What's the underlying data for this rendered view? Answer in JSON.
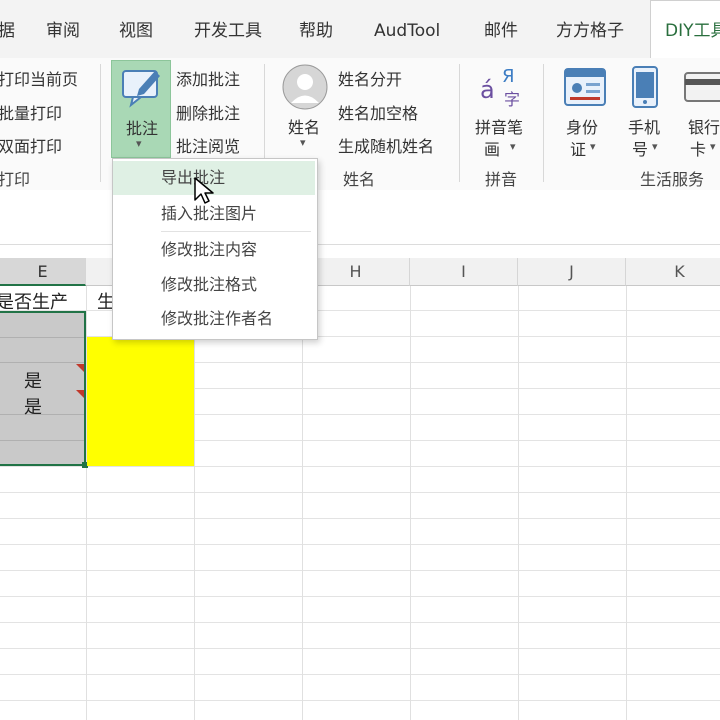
{
  "tabs": [
    "据",
    "审阅",
    "视图",
    "开发工具",
    "帮助",
    "AudTool",
    "邮件",
    "方方格子",
    "DIY工具"
  ],
  "ribbon": {
    "print": {
      "items": [
        "打印当前页",
        "批量打印",
        "双面打印"
      ],
      "group_label": "打印"
    },
    "comment": {
      "button_label": "批注",
      "items": [
        "添加批注",
        "删除批注",
        "批注阅览"
      ]
    },
    "name": {
      "button_label": "姓名",
      "items": [
        "姓名分开",
        "姓名加空格",
        "生成随机姓名"
      ],
      "group_label": "姓名"
    },
    "pinyin": {
      "button_label_line1": "拼音笔",
      "button_label_line2": "画",
      "group_label": "拼音",
      "icon_glyphs": [
        "á",
        "Я",
        "字"
      ]
    },
    "life": {
      "buttons": [
        {
          "line1": "身份",
          "line2": "证"
        },
        {
          "line1": "手机",
          "line2": "号"
        },
        {
          "line1": "银行",
          "line2": "卡"
        }
      ],
      "group_label": "生活服务"
    }
  },
  "dropdown": {
    "items": [
      "导出批注",
      "插入批注图片",
      "修改批注内容",
      "修改批注格式",
      "修改批注作者名"
    ],
    "hovered_index": 0
  },
  "sheet": {
    "columns": [
      "E",
      "H",
      "I",
      "J",
      "K"
    ],
    "cells": {
      "e_header": "是否生产",
      "f_header_partial": "生",
      "e_row4": "是",
      "e_row5": "是"
    },
    "colors": {
      "selection_gray": "#c9c9c9",
      "highlight_yellow": "#ffff00",
      "comment_marker": "#c0392b",
      "accent_green": "#217346"
    }
  }
}
